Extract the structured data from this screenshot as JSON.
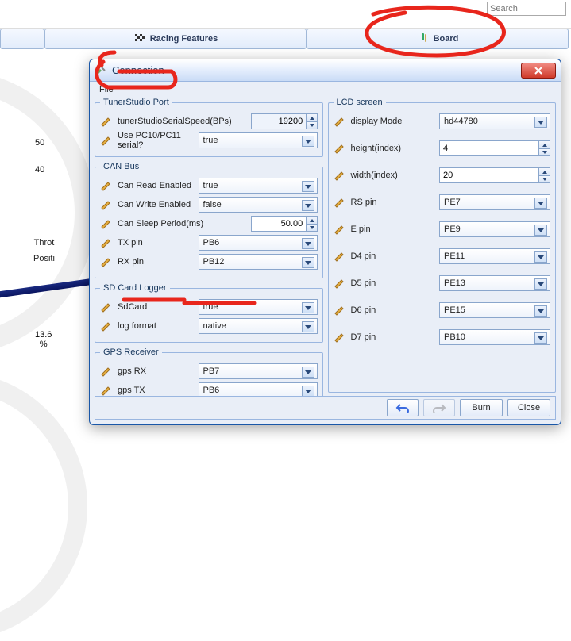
{
  "search": {
    "placeholder": "Search"
  },
  "tabs": {
    "racing": {
      "label": "Racing Features"
    },
    "board": {
      "label": "Board"
    }
  },
  "gauge": {
    "tick50": "50",
    "tick40": "40",
    "title_line1": "Throt",
    "title_line2": "Positi",
    "value": "13.6",
    "unit": "%"
  },
  "dialog": {
    "title": "Connection",
    "menu_file": "File",
    "groups": {
      "tuner": {
        "legend": "TunerStudio Port",
        "speed_label": "tunerStudioSerialSpeed(BPs)",
        "speed_value": "19200",
        "usepc_label": "Use PC10/PC11 serial?",
        "usepc_value": "true"
      },
      "can": {
        "legend": "CAN Bus",
        "read_label": "Can Read Enabled",
        "read_value": "true",
        "write_label": "Can Write Enabled",
        "write_value": "false",
        "sleep_label": "Can Sleep Period(ms)",
        "sleep_value": "50.00",
        "tx_label": "TX pin",
        "tx_value": "PB6",
        "rx_label": "RX pin",
        "rx_value": "PB12"
      },
      "sd": {
        "legend": "SD Card Logger",
        "sd_label": "SdCard",
        "sd_value": "true",
        "log_label": "log format",
        "log_value": "native"
      },
      "gps": {
        "legend": "GPS Receiver",
        "rx_label": "gps RX",
        "rx_value": "PB7",
        "tx_label": "gps TX",
        "tx_value": "PB6"
      },
      "lcd": {
        "legend": "LCD screen",
        "mode_label": "display Mode",
        "mode_value": "hd44780",
        "height_label": "height(index)",
        "height_value": "4",
        "width_label": "width(index)",
        "width_value": "20",
        "rs_label": "RS pin",
        "rs_value": "PE7",
        "e_label": "E pin",
        "e_value": "PE9",
        "d4_label": "D4 pin",
        "d4_value": "PE11",
        "d5_label": "D5 pin",
        "d5_value": "PE13",
        "d6_label": "D6 pin",
        "d6_value": "PE15",
        "d7_label": "D7 pin",
        "d7_value": "PB10"
      }
    },
    "footer": {
      "burn": "Burn",
      "close": "Close"
    }
  }
}
